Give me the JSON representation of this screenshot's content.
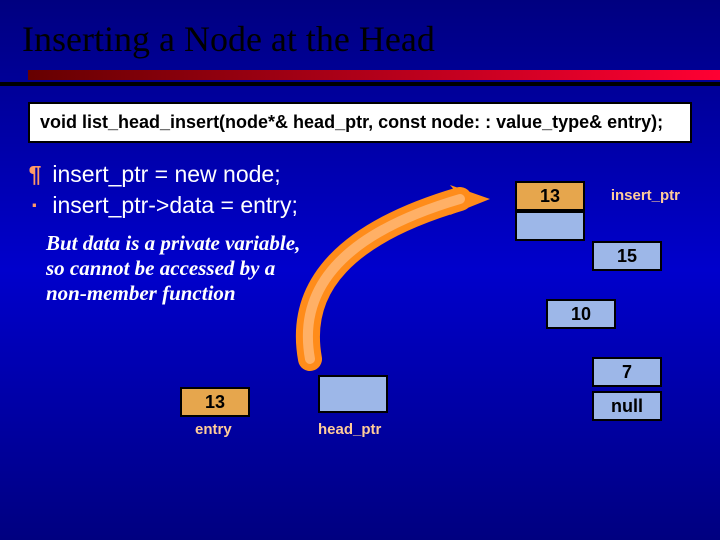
{
  "title": "Inserting a Node at the Head",
  "signature": "void list_head_insert(node*& head_ptr, const node: : value_type& entry);",
  "steps": {
    "bullet1": "¶",
    "line1": "insert_ptr = new node;",
    "bullet2": "·",
    "line2": "insert_ptr->data = entry;"
  },
  "note": "But data is a private variable, so cannot be accessed by a non-member function",
  "entry": {
    "value": "13",
    "label": "entry"
  },
  "headptr_label": "head_ptr",
  "insert_ptr_label": "insert_ptr",
  "nodes": {
    "n13": "13",
    "n15": "15",
    "n10": "10",
    "n7": "7",
    "nnull": "null"
  }
}
